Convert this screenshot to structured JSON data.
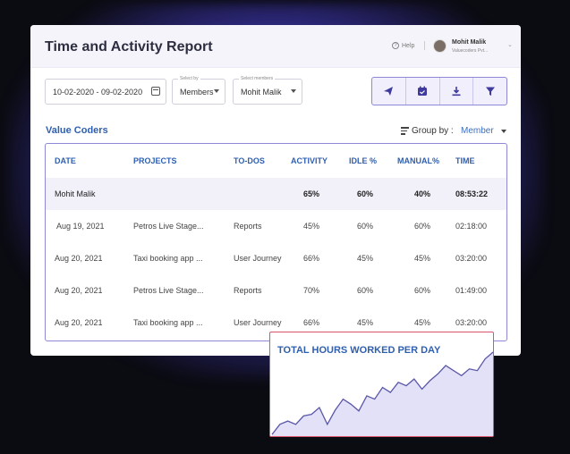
{
  "header": {
    "title": "Time and Activity Report",
    "help_label": "Help",
    "user_name": "Mohit Malik",
    "user_org": "Valuecoders Pvt..."
  },
  "filters": {
    "date_range": "10-02-2020 - 09-02-2020",
    "select_by_caption": "Select by",
    "select_by_value": "Members",
    "select_members_caption": "Select members",
    "select_members_value": "Mohit Malik"
  },
  "toolbar_icons": [
    "send-icon",
    "calendar-check-icon",
    "download-icon",
    "filter-icon"
  ],
  "section": {
    "company": "Value Coders",
    "group_by_label": "Group by :",
    "group_by_value": "Member"
  },
  "table": {
    "columns": [
      "DATE",
      "PROJECTS",
      "TO-DOS",
      "ACTIVITY",
      "IDLE %",
      "MANUAL%",
      "TIME"
    ],
    "summary": {
      "name": "Mohit Malik",
      "activity": "65%",
      "idle": "60%",
      "manual": "40%",
      "time": "08:53:22"
    },
    "rows": [
      {
        "date": "Aug 19, 2021",
        "project": "Petros Live Stage...",
        "todo": "Reports",
        "activity": "45%",
        "idle": "60%",
        "manual": "60%",
        "time": "02:18:00"
      },
      {
        "date": "Aug 20, 2021",
        "project": "Taxi booking app ...",
        "todo": "User Journey",
        "activity": "66%",
        "idle": "45%",
        "manual": "45%",
        "time": "03:20:00"
      },
      {
        "date": "Aug 20, 2021",
        "project": "Petros Live Stage...",
        "todo": "Reports",
        "activity": "70%",
        "idle": "60%",
        "manual": "60%",
        "time": "01:49:00"
      },
      {
        "date": "Aug 20, 2021",
        "project": "Taxi booking app ...",
        "todo": "User Journey",
        "activity": "66%",
        "idle": "45%",
        "manual": "45%",
        "time": "03:20:00"
      }
    ]
  },
  "chart_data": {
    "type": "area",
    "title": "TOTAL HOURS WORKED PER DAY",
    "values": [
      2,
      14,
      18,
      14,
      24,
      26,
      34,
      14,
      31,
      44,
      38,
      30,
      48,
      44,
      58,
      52,
      64,
      60,
      68,
      56,
      66,
      74,
      84,
      78,
      72,
      80,
      78,
      92,
      100
    ],
    "ylim": [
      0,
      100
    ],
    "colors": {
      "line": "#5a57a8",
      "fill": "#e3e1f7",
      "border": "#d9556d"
    }
  },
  "colors": {
    "accent": "#2f5fae",
    "toolbar": "#3e3a9e",
    "glow": "#5a50d6"
  }
}
